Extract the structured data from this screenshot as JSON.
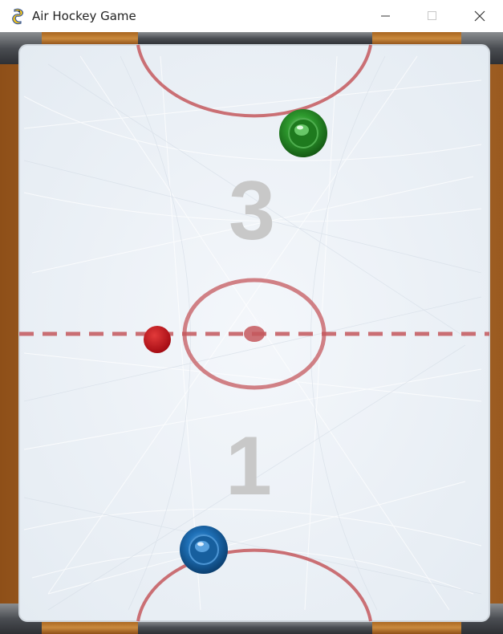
{
  "window": {
    "title": "Air Hockey Game",
    "controls": [
      "minimize",
      "maximize",
      "close"
    ],
    "icon": "pygame-snake-icon"
  },
  "game": {
    "score_top": "3",
    "score_bottom": "1",
    "colors": {
      "ice": "#eef3f8",
      "line": "#c4585d",
      "wood": "#b5702c",
      "top_mallet": "#2e8b2e",
      "bottom_mallet": "#1e6fb5",
      "puck": "#c21018",
      "score_digits": "#c8c8c8"
    }
  }
}
